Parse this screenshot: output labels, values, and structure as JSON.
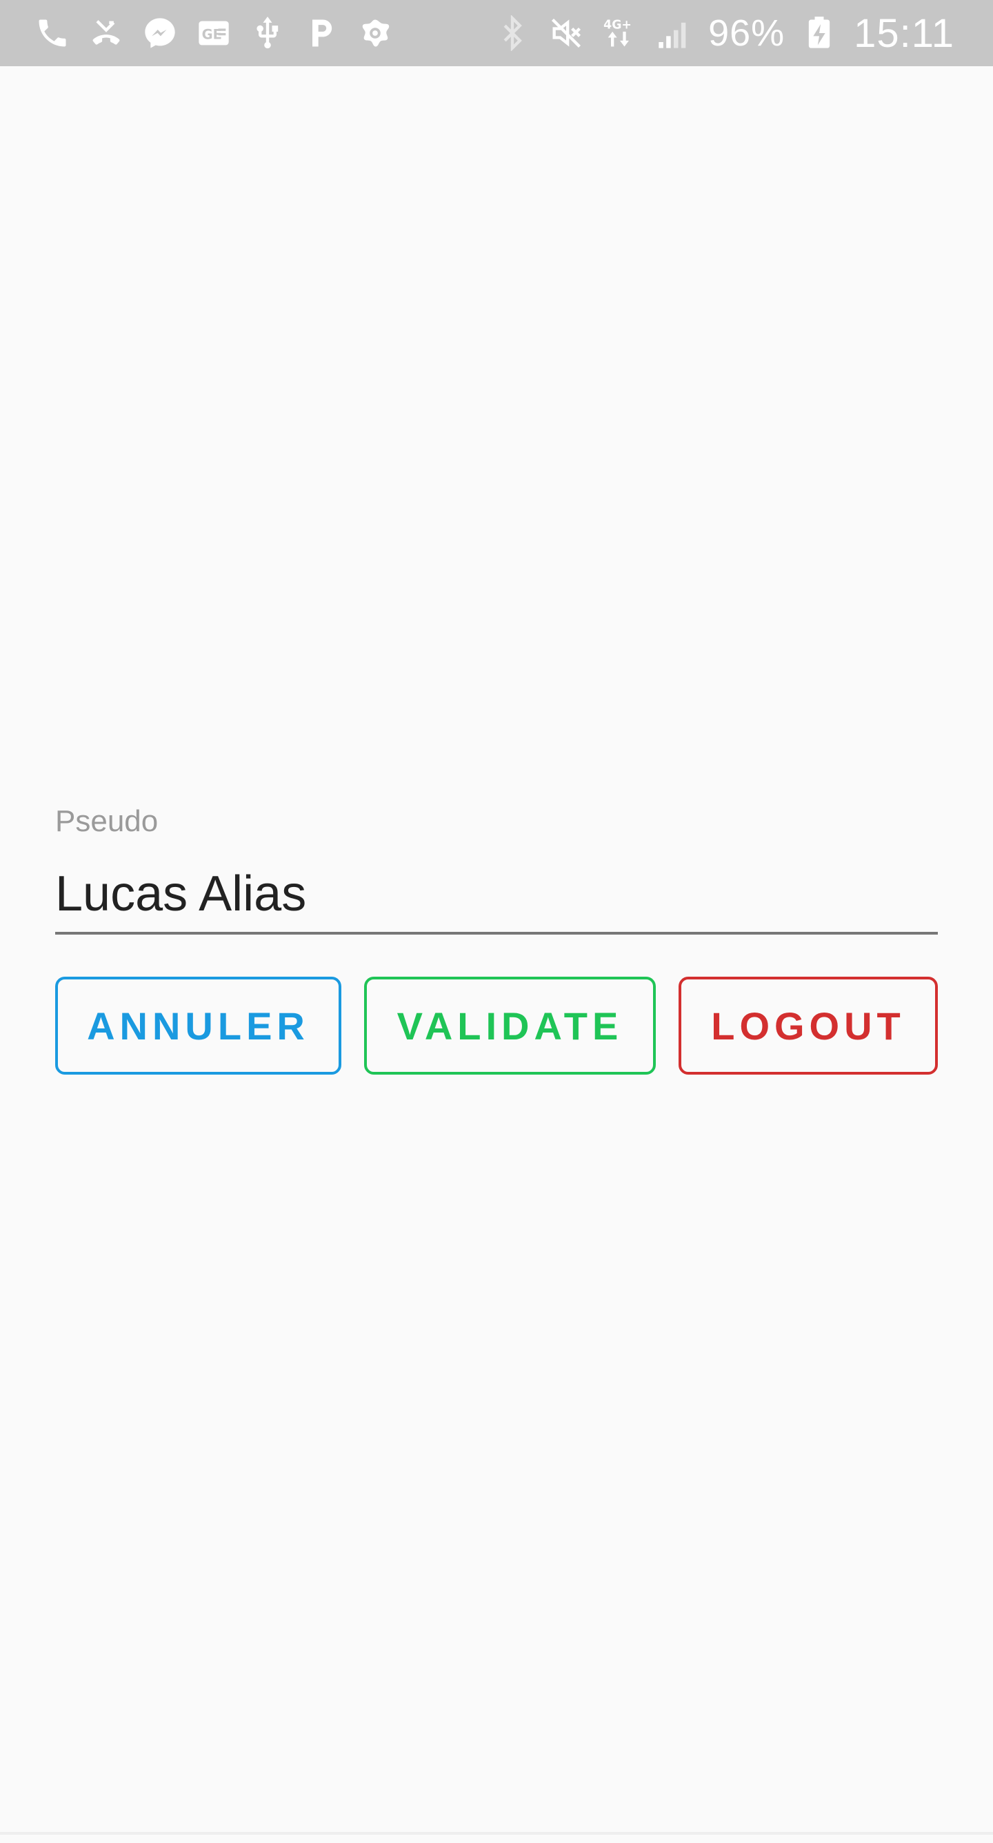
{
  "status_bar": {
    "left_icons": [
      "phone-icon",
      "missed-call-icon",
      "messenger-icon",
      "ge-app-icon",
      "usb-icon",
      "parking-app-icon",
      "avast-icon"
    ],
    "right_icons": [
      "bluetooth-icon",
      "mute-icon",
      "4g-data-icon",
      "signal-icon",
      "battery-charging-icon"
    ],
    "network_label": "4G+",
    "battery": "96%",
    "time": "15:11",
    "background": "#c6c6c6"
  },
  "form": {
    "pseudo_label": "Pseudo",
    "pseudo_value": "Lucas Alias"
  },
  "buttons": {
    "cancel_label": "ANNULER",
    "validate_label": "VALIDATE",
    "logout_label": "LOGOUT"
  },
  "colors": {
    "cancel": "#1a9ae0",
    "validate": "#1fc456",
    "logout": "#d32f2f"
  }
}
